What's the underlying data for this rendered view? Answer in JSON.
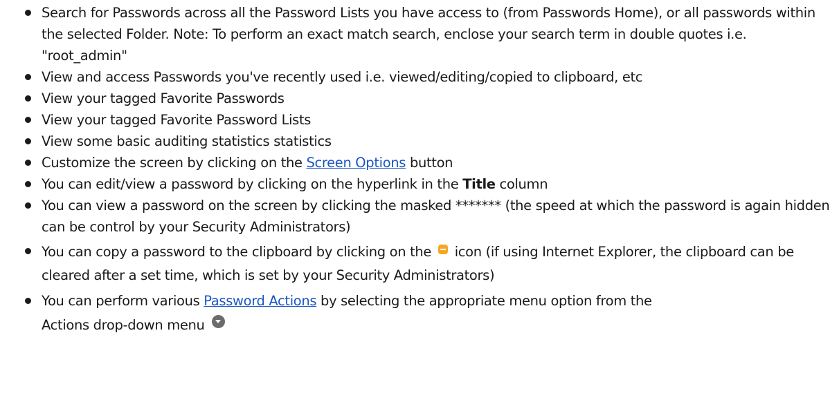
{
  "items": [
    {
      "text": "Search for Passwords across all the Password Lists you have access to (from Passwords Home), or all passwords within the selected Folder. Note: To perform an exact match search, enclose your search term in double quotes i.e. \"root_admin\""
    },
    {
      "text": "View and access Passwords you've recently used i.e. viewed/editing/copied to clipboard, etc"
    },
    {
      "text": "View your tagged Favorite Passwords"
    },
    {
      "text": "View your tagged Favorite Password Lists"
    },
    {
      "text": "View some basic auditing statistics statistics"
    },
    {
      "before": "Customize the screen by clicking on the ",
      "link": "Screen Options",
      "after": " button"
    },
    {
      "before": "You can edit/view a password by clicking on the hyperlink in the ",
      "bold": "Title",
      "after": " column"
    },
    {
      "text": "You can view a password on the screen by clicking the masked ******* (the speed at which the password is again hidden can be control by your Security Administrators)"
    },
    {
      "before": "You can copy a password to the clipboard by clicking on the ",
      "after": " icon (if using Internet Explorer, the clipboard can be cleared after a set time, which is set by your Security Administrators)"
    },
    {
      "before": "You can perform various ",
      "link": "Password Actions",
      "after": " by selecting the appropriate menu option from the",
      "line2": "Actions drop-down menu"
    }
  ],
  "icons": {
    "clipboard": "clipboard-copy-icon",
    "actions": "actions-dropdown-icon"
  },
  "colors": {
    "link": "#1a56c4",
    "clipboard_icon": "#f6a623",
    "actions_icon": "#6b6b6b"
  }
}
